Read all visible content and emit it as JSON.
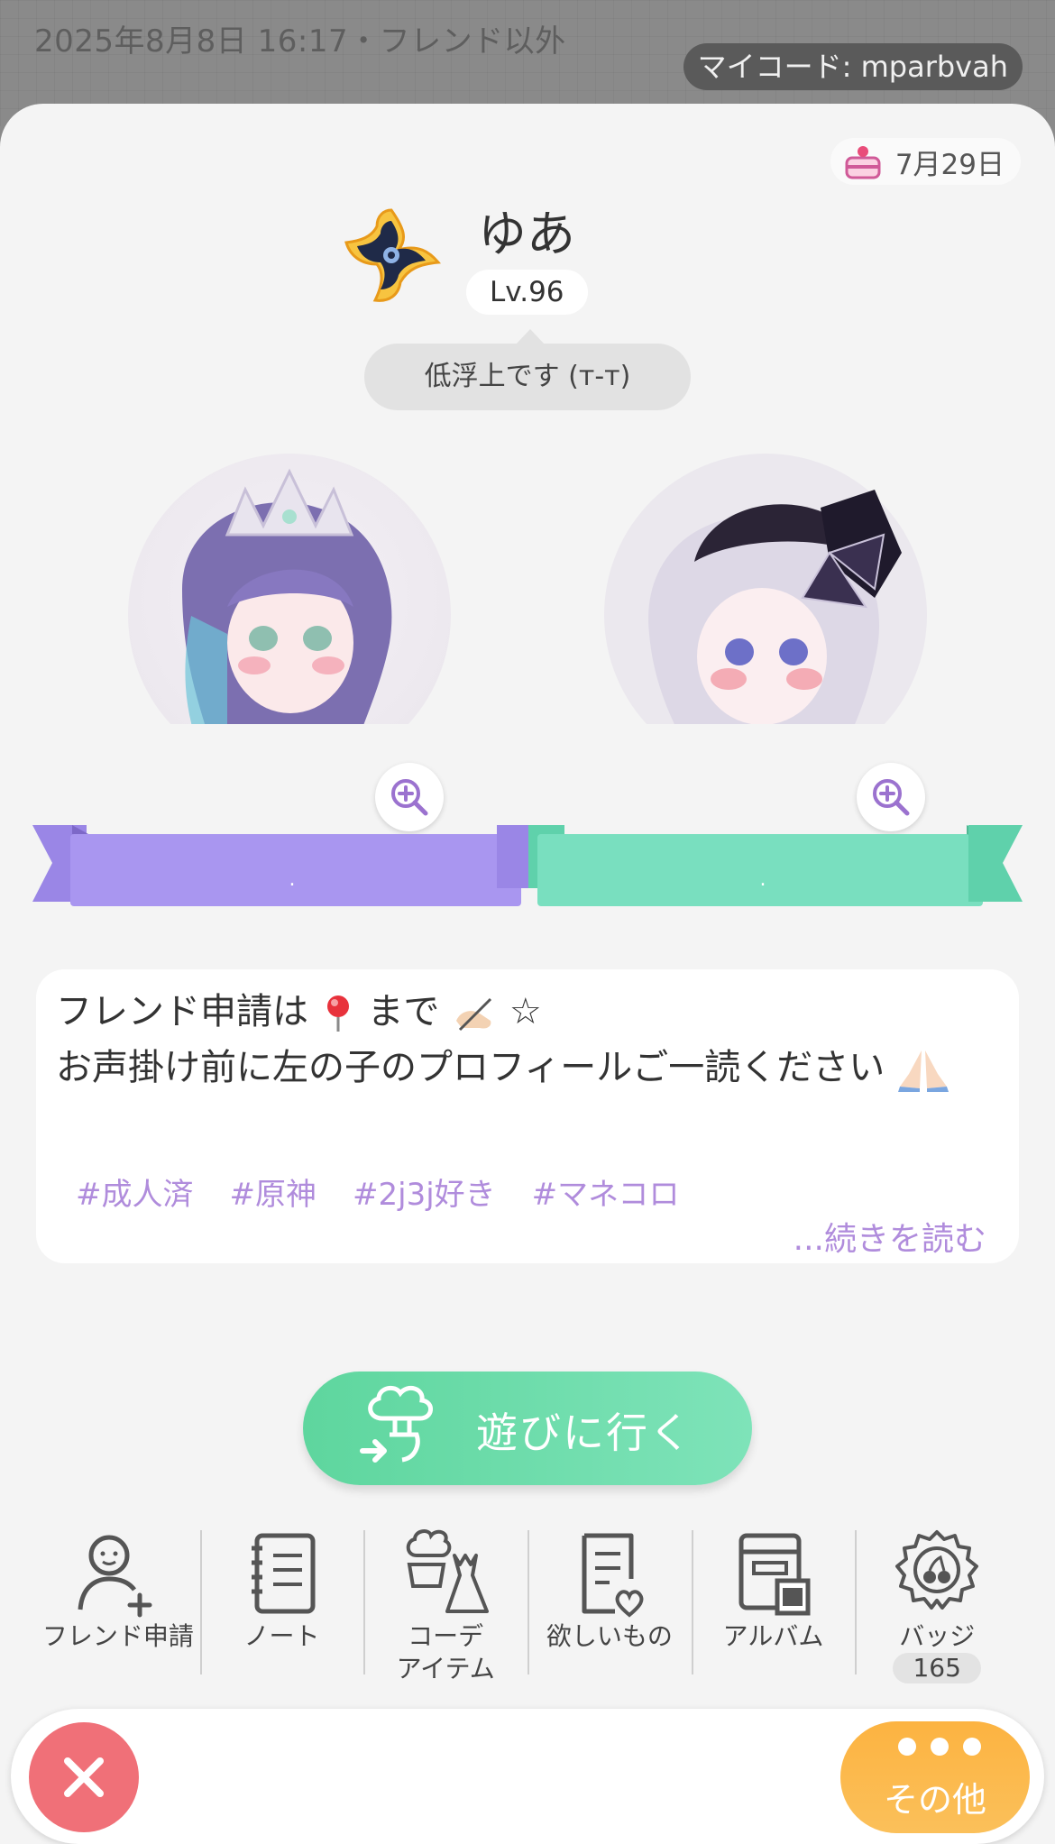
{
  "top": {
    "datetime_text": "2025年8月8日 16:17・フレンド以外",
    "my_code": "マイコード: mparbvah"
  },
  "profile": {
    "birthday": "7月29日",
    "name": "ゆあ",
    "level": "Lv.96",
    "status": "低浮上です (т-т)",
    "badge_icon": "shuriken-badge-icon"
  },
  "avatars": {
    "left_ribbon_name": ".",
    "right_ribbon_name": ".",
    "left_ribbon_color": "#a996f0",
    "right_ribbon_color": "#79dfbf"
  },
  "bio": {
    "line1_a": "フレンド申請は",
    "line1_b": "まで",
    "line1_c": "☆",
    "line2": "お声掛け前に左の子のプロフィールご一読ください",
    "tags": [
      "#成人済",
      "#原神",
      "#2j3j好き",
      "#マネコロ"
    ],
    "read_more": "...続きを読む",
    "accent_color": "#b08cdc"
  },
  "play_button": {
    "label": "遊びに行く"
  },
  "menu": {
    "friend_request": "フレンド申請",
    "note": "ノート",
    "coord_line1": "コーデ",
    "coord_line2": "アイテム",
    "wishlist": "欲しいもの",
    "album": "アルバム",
    "badge": "バッジ",
    "badge_count": "165"
  },
  "bottom": {
    "more_label": "その他"
  }
}
